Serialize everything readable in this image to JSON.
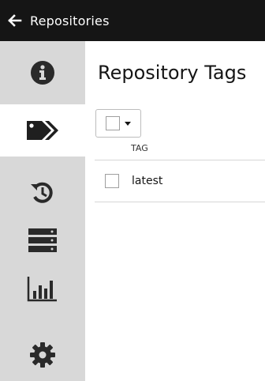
{
  "header": {
    "back_label": "Repositories"
  },
  "sidebar": {
    "items": [
      {
        "icon": "info-icon",
        "active": false
      },
      {
        "icon": "tags-icon",
        "active": true
      },
      {
        "icon": "history-icon",
        "active": false
      },
      {
        "icon": "builds-icon",
        "active": false
      },
      {
        "icon": "usage-logs-icon",
        "active": false
      },
      {
        "icon": "settings-icon",
        "active": false
      }
    ]
  },
  "main": {
    "title": "Repository Tags",
    "table": {
      "columns": [
        "TAG"
      ],
      "rows": [
        {
          "tag": "latest"
        }
      ]
    }
  },
  "colors": {
    "topbar": "#151515",
    "sidebar": "#d8d8d8",
    "icon": "#2a2a2a"
  }
}
